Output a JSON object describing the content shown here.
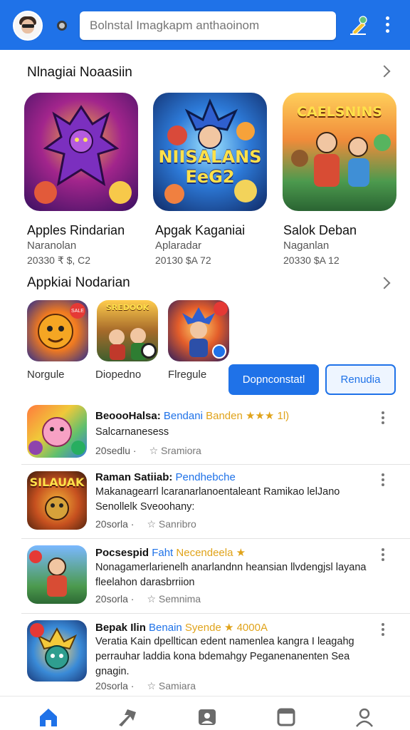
{
  "header": {
    "search_placeholder": "Bolnstal Imagkapm anthaoinom",
    "colors": {
      "primary": "#1f72e8"
    }
  },
  "featured": {
    "title": "Nlnagiai Noaasiin",
    "cards": [
      {
        "title": "Apples Rindarian",
        "subtitle": "Naranolan",
        "meta": "20330 ₹ $, C2",
        "art_text": ""
      },
      {
        "title": "Apgak Kaganiai",
        "subtitle": "Aplaradar",
        "meta": "20130 $A 72",
        "art_text": "NIISALANS EeG2"
      },
      {
        "title": "Salok Deban",
        "subtitle": "Naganlan",
        "meta": "20330 $A 12",
        "art_text": "CAELSNINS"
      }
    ]
  },
  "apps": {
    "title": "Appkiai Nodarian",
    "items": [
      {
        "label": "Norgule",
        "badge": "SALE"
      },
      {
        "label": "Diopedno",
        "art_text": "SREDOOK"
      },
      {
        "label": "Flregule",
        "badge": ""
      }
    ],
    "primary_button": "Dopnconstatl",
    "secondary_button": "Renudia"
  },
  "list": [
    {
      "title_a": "BeoooHalsa:",
      "title_b": "Bendani",
      "title_c": "Banden ★★★ 1l)",
      "desc": "Salcarnanesess",
      "meta": "20sedlu ·",
      "meta_star": "☆ Sramiora"
    },
    {
      "title_a": "Raman Satiiab:",
      "title_b": "Pendhebche",
      "title_c": "",
      "desc": "Makanagearrl lcaranarlanoentaleant Ramikao lelJano Senollelk Sveoohany:",
      "meta": "20sorla ·",
      "meta_star": "☆ Sanribro",
      "art_text": "SILAUAK"
    },
    {
      "title_a": "Pocsespid",
      "title_b": "Faht",
      "title_c": "Necendeela ★",
      "desc": "Nonagamerlarienelh anarlandnn heansian llvdengjsl layana fleelahon darasbrriion",
      "meta": "20sorla ·",
      "meta_star": "☆ Semnima"
    },
    {
      "title_a": "Bepak Ilin",
      "title_b": "Benain",
      "title_c": "Syende ★ 4000A",
      "desc": "Veratia Kain dpelltican edent namenlea kangra I leagahg perrauhar laddia kona bdemahgy Peganenanenten Sea gnagin.",
      "meta": "20sorla ·",
      "meta_star": "☆ Samiara"
    }
  ],
  "bottom_nav": [
    "home-icon",
    "explore-icon",
    "library-icon",
    "apps-icon",
    "profile-icon"
  ]
}
